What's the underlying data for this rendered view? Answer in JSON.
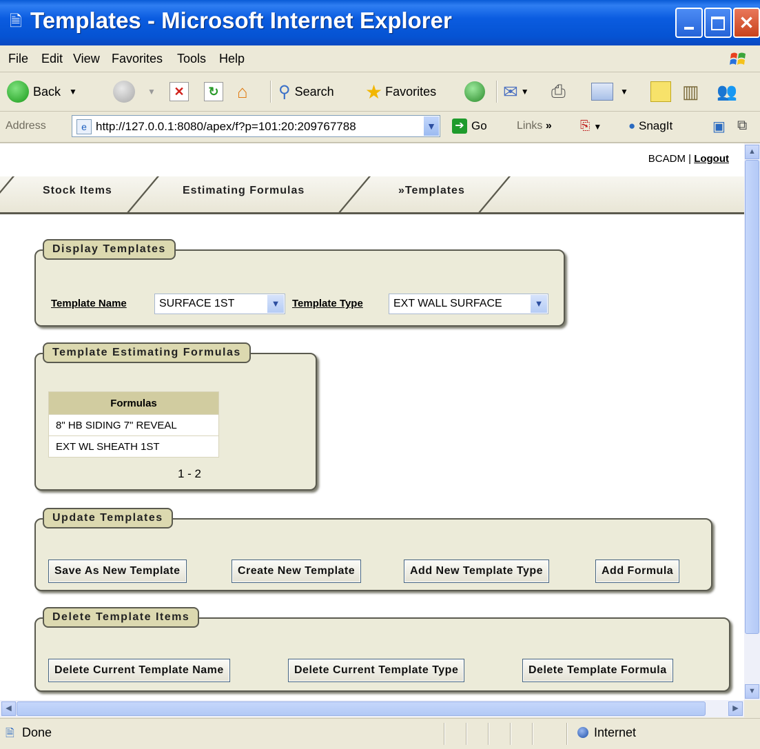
{
  "window": {
    "title": "Templates - Microsoft Internet Explorer"
  },
  "menu": [
    "File",
    "Edit",
    "View",
    "Favorites",
    "Tools",
    "Help"
  ],
  "toolbar": {
    "back": "Back",
    "search": "Search",
    "favorites": "Favorites"
  },
  "address": {
    "label": "Address",
    "url": "http://127.0.0.1:8080/apex/f?p=101:20:209767788",
    "go": "Go",
    "links": "Links",
    "snagit": "SnagIt"
  },
  "user": {
    "name": "BCADM",
    "sep": "|",
    "logout": "Logout"
  },
  "tabs": [
    "Stock Items",
    "Estimating Formulas",
    "»Templates"
  ],
  "display": {
    "legend": "Display Templates",
    "name_label": "Template Name",
    "name_value": "SURFACE 1ST",
    "type_label": "Template Type",
    "type_value": "EXT WALL SURFACE"
  },
  "formulas": {
    "legend": "Template Estimating Formulas",
    "header": "Formulas",
    "rows": [
      "8\" HB SIDING 7\" REVEAL",
      "EXT WL SHEATH 1ST"
    ],
    "pager": "1 - 2"
  },
  "update": {
    "legend": "Update Templates",
    "buttons": [
      "Save As New Template",
      "Create New Template",
      "Add New Template Type",
      "Add Formula"
    ]
  },
  "delete": {
    "legend": "Delete Template Items",
    "buttons": [
      "Delete Current Template Name",
      "Delete Current Template Type",
      "Delete Template Formula"
    ]
  },
  "status": {
    "text": "Done",
    "zone": "Internet"
  },
  "colors": {
    "titlebar": "#0553d3",
    "region": "#ecebd9",
    "legend": "#dcd9b0",
    "table_header": "#d1cca0"
  }
}
